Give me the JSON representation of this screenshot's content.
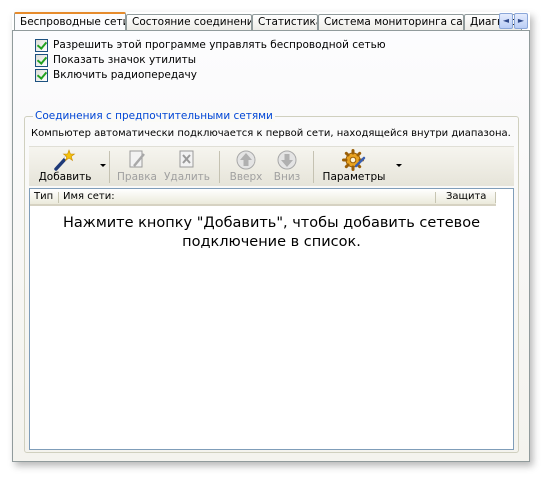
{
  "tabs": [
    {
      "label": "Беспроводные сети",
      "active": true
    },
    {
      "label": "Состояние соединения"
    },
    {
      "label": "Статистика"
    },
    {
      "label": "Система мониторинга сайта"
    },
    {
      "label": "Диагности"
    }
  ],
  "tab_scroll": {
    "left_icon": "◄",
    "right_icon": "►"
  },
  "checkboxes": [
    {
      "label": "Разрешить этой программе управлять беспроводной сетью",
      "checked": true
    },
    {
      "label": "Показать значок утилиты",
      "checked": true
    },
    {
      "label": "Включить радиопередачу",
      "checked": true
    }
  ],
  "group": {
    "title": "Соединения с предпочтительными сетями",
    "description": "Компьютер автоматически подключается к первой сети, находящейся внутри диапазона."
  },
  "toolbar": {
    "add": "Добавить",
    "edit": "Правка",
    "delete": "Удалить",
    "up": "Вверх",
    "down": "Вниз",
    "params": "Параметры"
  },
  "list": {
    "columns": {
      "type": "Тип",
      "name": "Имя сети:",
      "security": "Защита"
    },
    "empty_message": "Нажмите кнопку \"Добавить\", чтобы добавить сетевое подключение в список."
  },
  "colors": {
    "accent": "#e68b2c",
    "group_title": "#0046d5",
    "check": "#21a121"
  }
}
